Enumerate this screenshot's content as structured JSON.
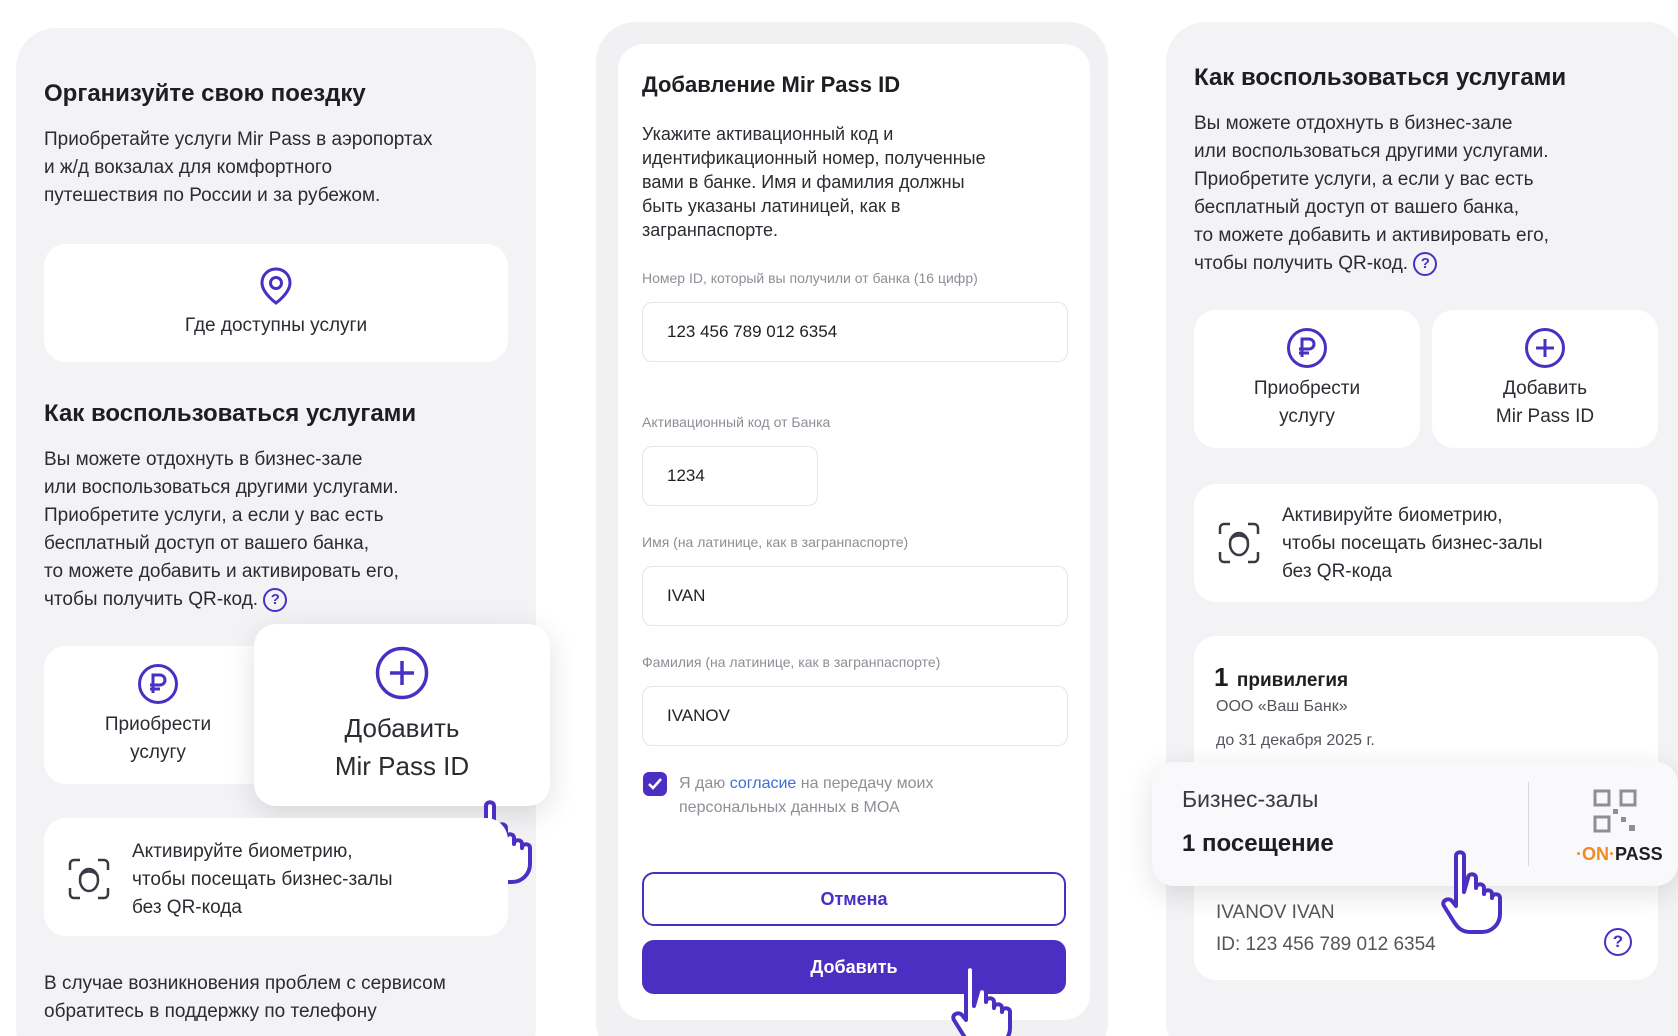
{
  "left": {
    "trip_title": "Организуйте свою поездку",
    "trip_text_1": "Приобретайте услуги Mir Pass в аэропортах",
    "trip_text_2": "и ж/д вокзалах для комфортного",
    "trip_text_3": "путешествия по России и за рубежом.",
    "where_label": "Где доступны услуги",
    "how_title": "Как воспользоваться услугами",
    "how_lines": [
      "Вы можете отдохнуть в бизнес-зале",
      "или воспользоваться другими услугами.",
      "Приобретите услуги, а если у вас есть",
      "бесплатный доступ от вашего банка,",
      "то можете добавить и активировать его,",
      "чтобы получить QR-код."
    ],
    "buy_label_1": "Приобрести",
    "buy_label_2": "услугу",
    "add_label_1": "Добавить",
    "add_label_2": "Mir Pass ID",
    "bio_1": "Активируйте биометрию,",
    "bio_2": "чтобы посещать бизнес-залы",
    "bio_3": "без QR-кода",
    "support_1": "В случае возникновения проблем с сервисом",
    "support_2": "обратитесь в поддержку по телефону"
  },
  "form": {
    "title": "Добавление Mir Pass ID",
    "intro_lines": [
      "Укажите активационный код и",
      "идентификационный номер, полученные",
      "вами в банке. Имя и фамилия должны",
      "быть указаны латиницей, как в",
      "загранпаспорте."
    ],
    "id_label": "Номер ID, который вы получили от банка (16 цифр)",
    "id_value": "123 456 789 012 6354",
    "code_label": "Активационный код от Банка",
    "code_value": "1234",
    "name_label": "Имя (на латинице, как в загранпаспорте)",
    "name_value": "IVAN",
    "surname_label": "Фамилия (на латинице, как в загранпаспорте)",
    "surname_value": "IVANOV",
    "consent_pre": "Я даю ",
    "consent_link": "согласие",
    "consent_post": " на передачу моих",
    "consent_line2": "персональных данных в МОА",
    "consent_checked": true,
    "cancel_label": "Отмена",
    "add_label": "Добавить"
  },
  "right": {
    "how_title": "Как воспользоваться услугами",
    "how_lines": [
      "Вы можете отдохнуть в бизнес-зале",
      "или воспользоваться другими услугами.",
      "Приобретите услуги, а если у вас есть",
      "бесплатный доступ от вашего банка,",
      "то можете добавить и активировать его,",
      "чтобы получить QR-код."
    ],
    "buy_label_1": "Приобрести",
    "buy_label_2": "услугу",
    "add_label_1": "Добавить",
    "add_label_2": "Mir Pass ID",
    "bio_1": "Активируйте биометрию,",
    "bio_2": "чтобы посещать бизнес-залы",
    "bio_3": "без QR-кода",
    "priv_count": "1",
    "priv_word": "привилегия",
    "bank": "ООО «Ваш Банк»",
    "until": "до 31 декабря 2025 г.",
    "lounge_title": "Бизнес-залы",
    "lounge_visits": "1 посещение",
    "onpass_on": "ON",
    "onpass_pass": "PASS",
    "holder": "IVANOV IVAN",
    "holder_id": "ID: 123 456 789 012 6354"
  },
  "colors": {
    "accent": "#4a2fc2",
    "orange": "#f08a24",
    "panel": "#f3f3f5"
  }
}
